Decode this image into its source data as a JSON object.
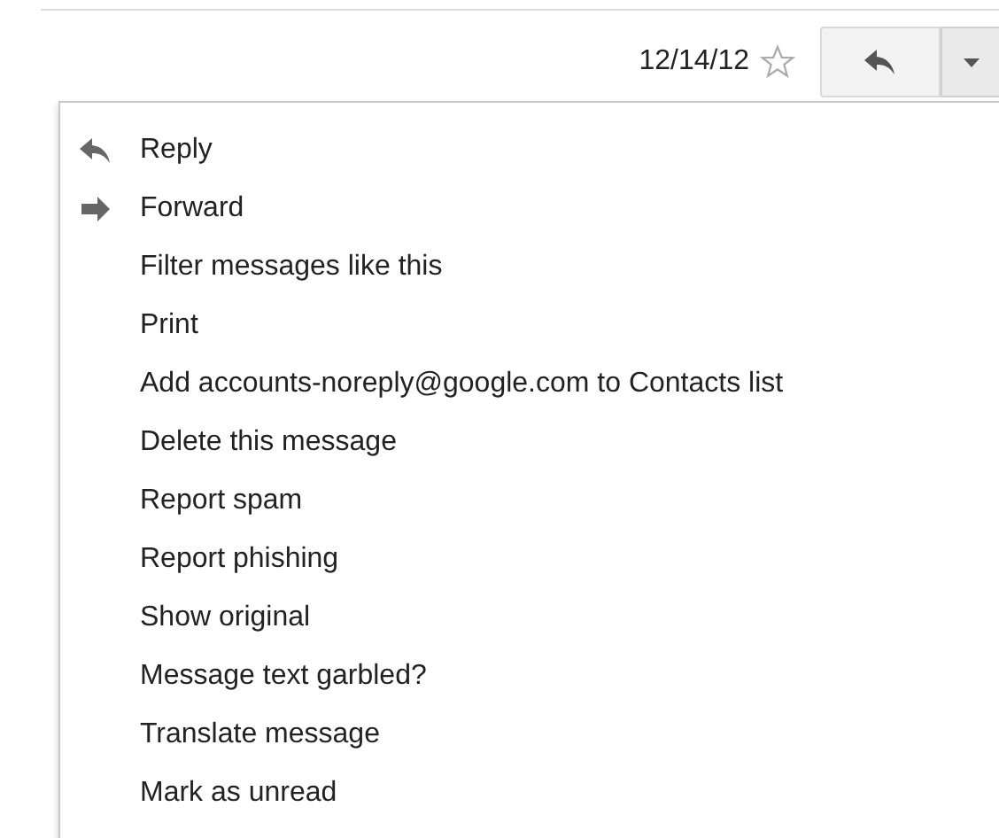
{
  "header": {
    "date": "12/14/12",
    "starred": false
  },
  "menu": [
    {
      "label": "Reply",
      "kind": "reply"
    },
    {
      "label": "Forward",
      "kind": "forward"
    },
    {
      "label": "Filter messages like this",
      "kind": "plain"
    },
    {
      "label": "Print",
      "kind": "plain"
    },
    {
      "label": "Add accounts-noreply@google.com to Contacts list",
      "kind": "plain"
    },
    {
      "label": "Delete this message",
      "kind": "plain"
    },
    {
      "label": "Report spam",
      "kind": "plain"
    },
    {
      "label": "Report phishing",
      "kind": "plain"
    },
    {
      "label": "Show original",
      "kind": "plain"
    },
    {
      "label": "Message text garbled?",
      "kind": "plain"
    },
    {
      "label": "Translate message",
      "kind": "plain"
    },
    {
      "label": "Mark as unread",
      "kind": "plain"
    }
  ]
}
